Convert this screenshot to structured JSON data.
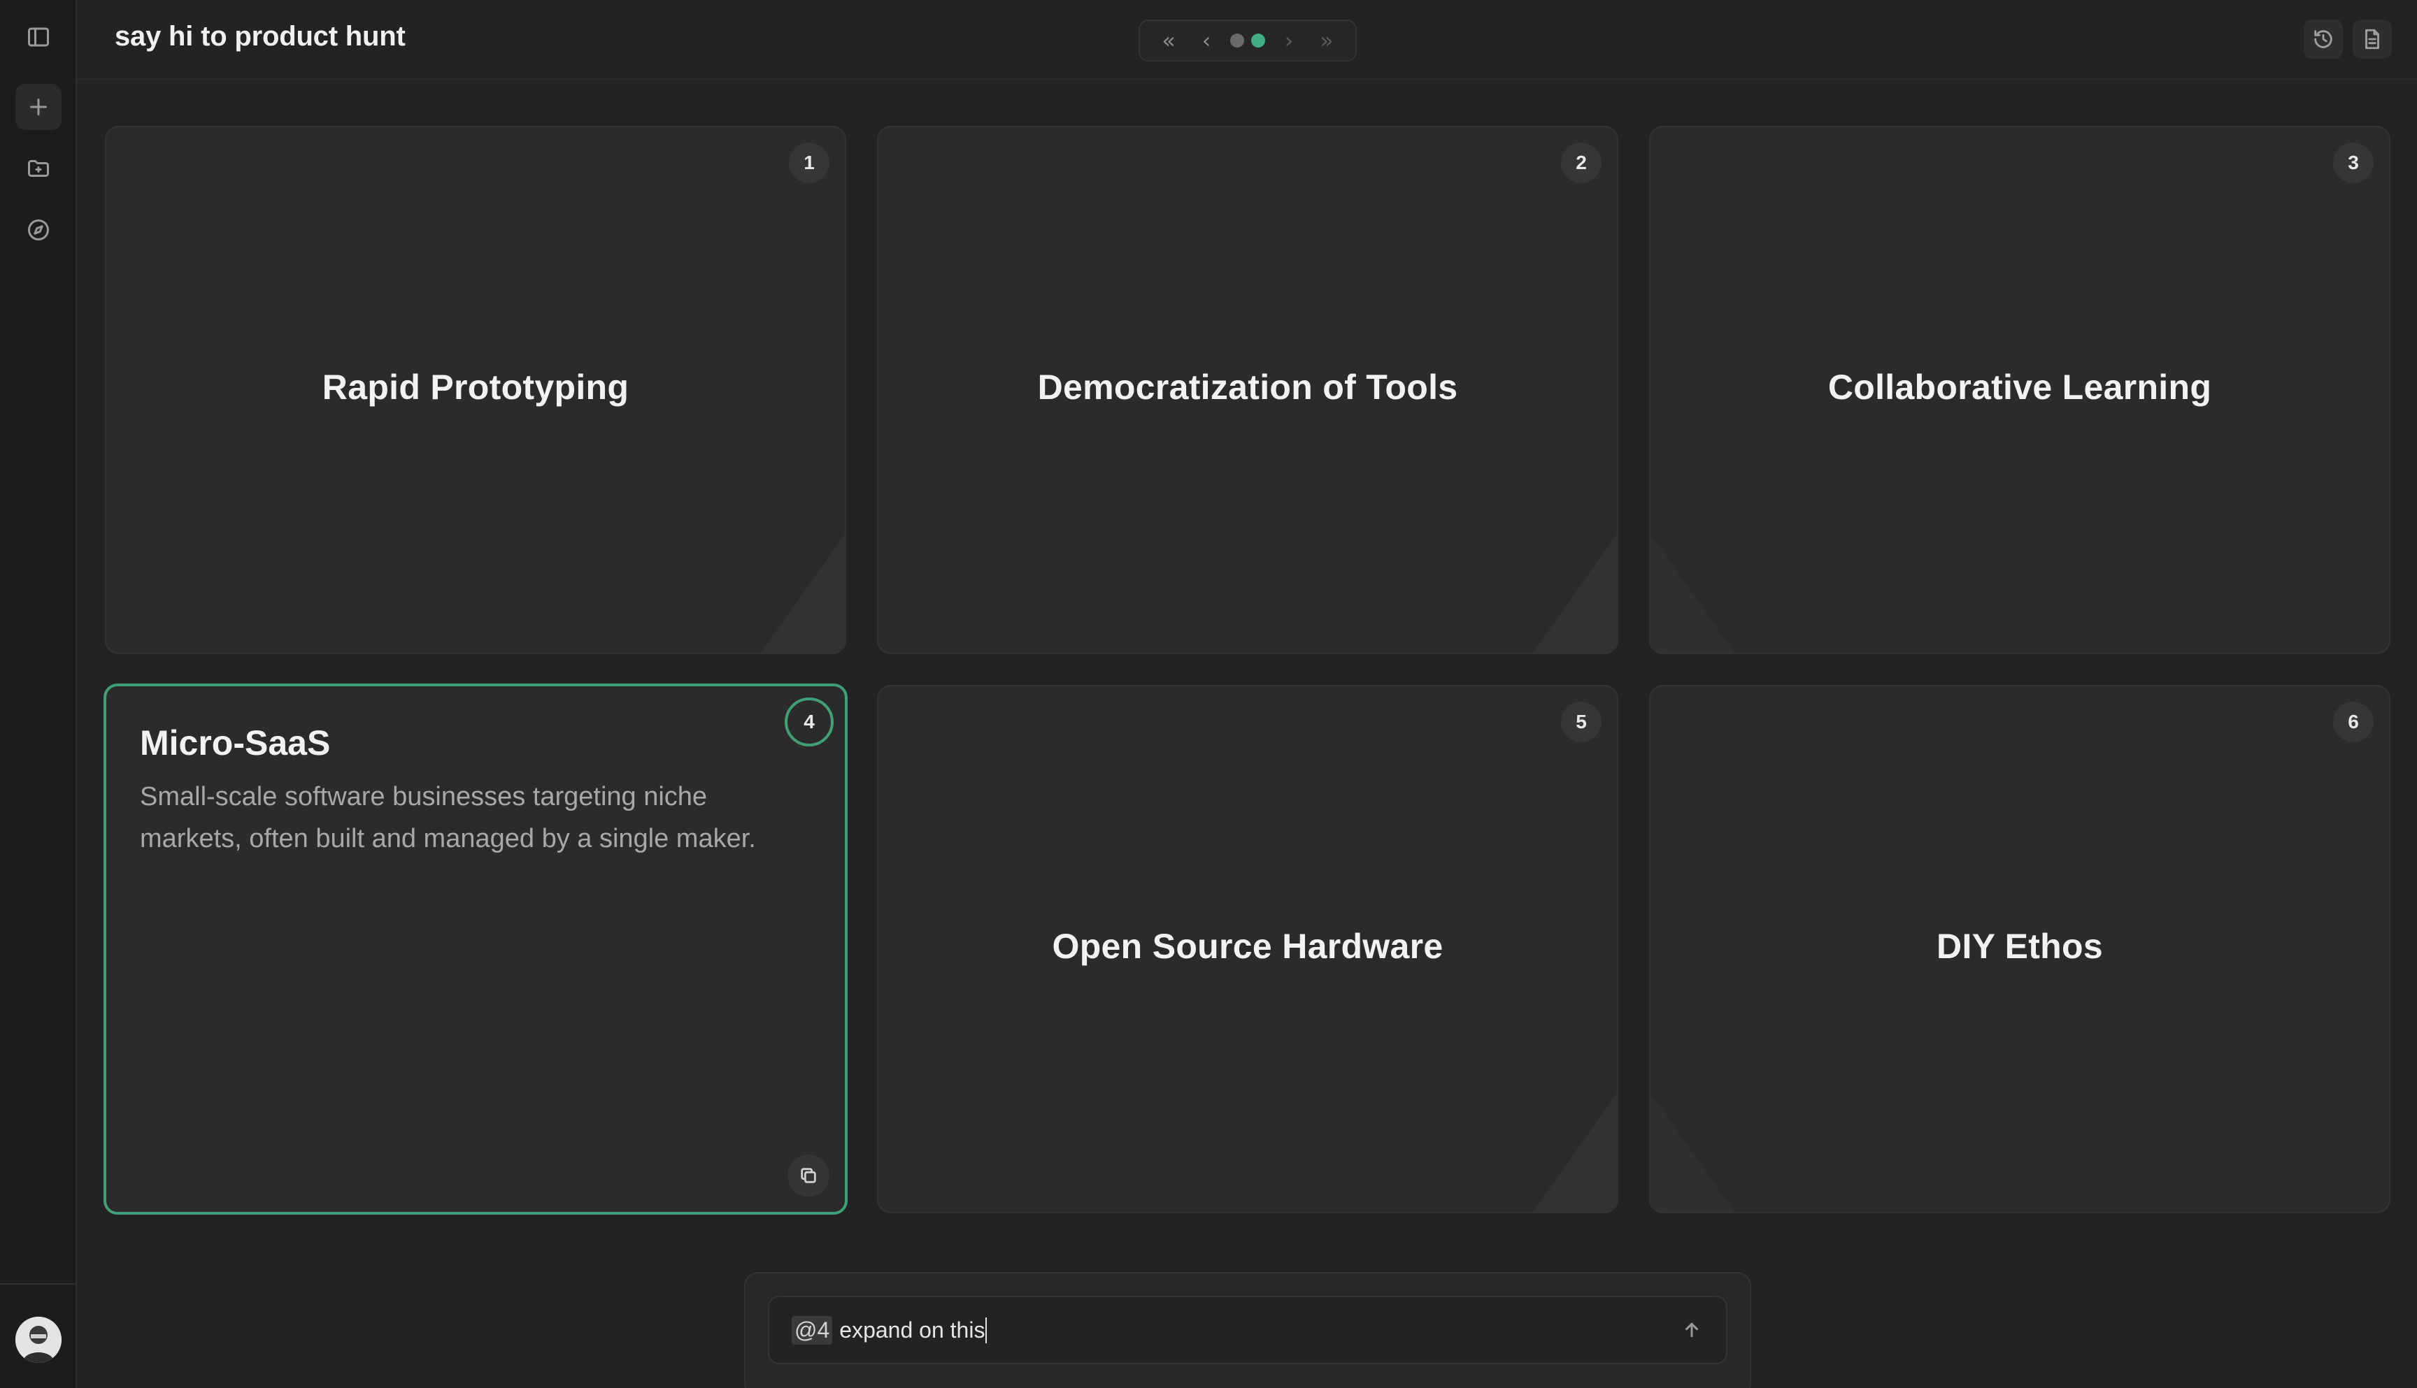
{
  "document": {
    "title": "say hi to product hunt"
  },
  "pager": {
    "first": "«",
    "prev": "‹",
    "next": "›",
    "last": "»",
    "pages": 2,
    "current": 2
  },
  "sidebar": {
    "icons": [
      "sidebar-toggle-icon",
      "plus-icon",
      "folder-icon",
      "compass-icon"
    ]
  },
  "topbar": {
    "icons": [
      "history-icon",
      "document-icon"
    ]
  },
  "cards": [
    {
      "number": "1",
      "title": "Rapid Prototyping"
    },
    {
      "number": "2",
      "title": "Democratization of Tools"
    },
    {
      "number": "3",
      "title": "Collaborative Learning"
    },
    {
      "number": "4",
      "title": "Micro-SaaS",
      "description": "Small-scale software businesses targeting niche markets, often built and managed by a single maker."
    },
    {
      "number": "5",
      "title": "Open Source Hardware"
    },
    {
      "number": "6",
      "title": "DIY Ethos"
    }
  ],
  "composer": {
    "mention": "@4",
    "text": "expand on this"
  },
  "colors": {
    "accent": "#3fae84",
    "background": "#232323",
    "card": "#2b2b2b"
  }
}
